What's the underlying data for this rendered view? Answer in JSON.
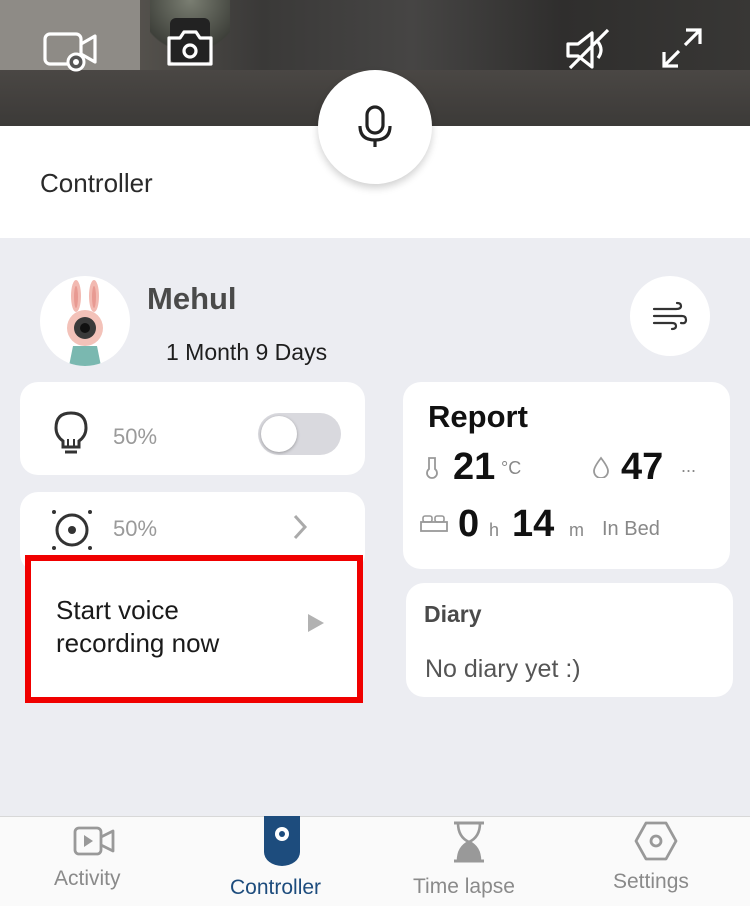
{
  "title": "Controller",
  "camera_toolbar": {
    "record_icon": "video-record-icon",
    "snapshot_icon": "camera-icon",
    "mute_icon": "speaker-muted-icon",
    "fullscreen_icon": "expand-icon",
    "talk_icon": "microphone-icon"
  },
  "profile": {
    "name": "Mehul",
    "age": "1 Month 9 Days",
    "avatar_icon": "bunny-camera-avatar",
    "wind_icon": "wind-icon"
  },
  "controls": {
    "night_light": {
      "icon": "lightbulb-icon",
      "level": "50%",
      "toggle_on": false
    },
    "projector": {
      "icon": "projector-icon",
      "level": "50%"
    },
    "voice_recording": {
      "label": "Start voice recording now",
      "icon": "play-icon"
    }
  },
  "report": {
    "title": "Report",
    "temperature": {
      "value": "21",
      "unit": "°C"
    },
    "humidity": {
      "value": "47",
      "unit": "..."
    },
    "sleep": {
      "hours": "0",
      "hours_unit": "h",
      "minutes": "14",
      "minutes_unit": "m",
      "status": "In Bed"
    }
  },
  "diary": {
    "title": "Diary",
    "text": "No diary yet :)"
  },
  "tabs": [
    {
      "label": "Activity",
      "icon": "video-play-icon",
      "active": false
    },
    {
      "label": "Controller",
      "icon": "camera-device-icon",
      "active": true
    },
    {
      "label": "Time lapse",
      "icon": "hourglass-icon",
      "active": false
    },
    {
      "label": "Settings",
      "icon": "hexagon-gear-icon",
      "active": false
    }
  ],
  "colors": {
    "accent": "#1d4c7d",
    "highlight_border": "#f00000",
    "background": "#ecedf2"
  }
}
